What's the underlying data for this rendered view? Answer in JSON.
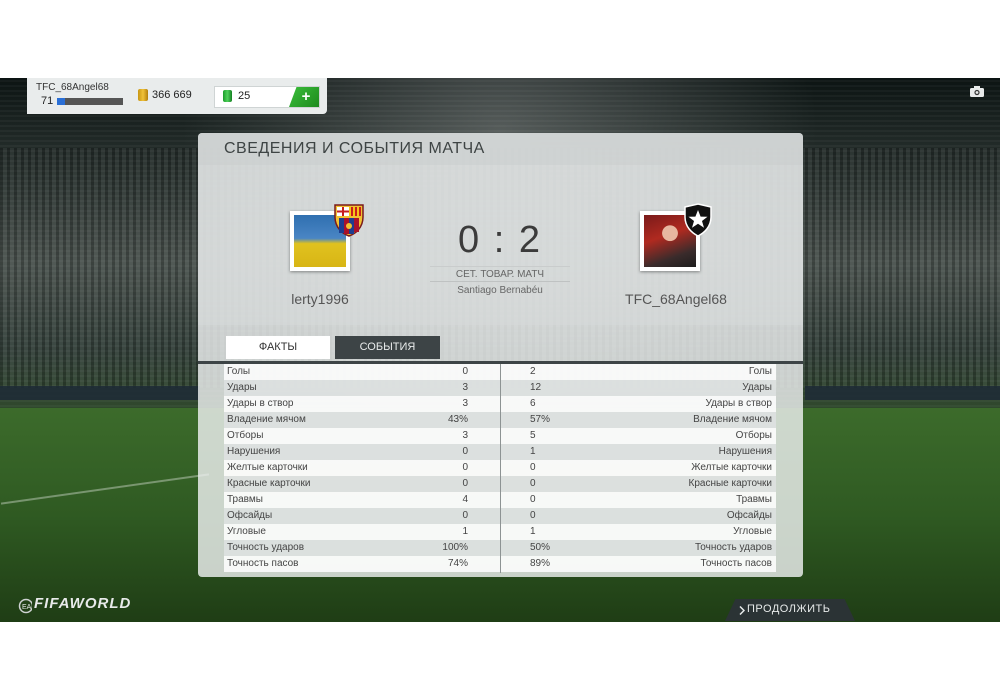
{
  "hud": {
    "player_name": "TFC_68Angel68",
    "level": "71",
    "coins": "366 669",
    "points": "25",
    "add_label": "+"
  },
  "panel": {
    "title": "СВЕДЕНИЯ И СОБЫТИЯ МАТЧА",
    "home_name": "lerty1996",
    "away_name": "TFC_68Angel68",
    "score": "0 : 2",
    "match_type": "СЕТ. ТОВАР. МАТЧ",
    "stadium": "Santiago Bernabéu",
    "tabs": [
      "ФАКТЫ",
      "СОБЫТИЯ"
    ]
  },
  "stats": [
    {
      "label": "Голы",
      "home": "0",
      "away": "2"
    },
    {
      "label": "Удары",
      "home": "3",
      "away": "12"
    },
    {
      "label": "Удары в створ",
      "home": "3",
      "away": "6"
    },
    {
      "label": "Владение мячом",
      "home": "43%",
      "away": "57%"
    },
    {
      "label": "Отборы",
      "home": "3",
      "away": "5"
    },
    {
      "label": "Нарушения",
      "home": "0",
      "away": "1"
    },
    {
      "label": "Желтые карточки",
      "home": "0",
      "away": "0"
    },
    {
      "label": "Красные карточки",
      "home": "0",
      "away": "0"
    },
    {
      "label": "Травмы",
      "home": "4",
      "away": "0"
    },
    {
      "label": "Офсайды",
      "home": "0",
      "away": "0"
    },
    {
      "label": "Угловые",
      "home": "1",
      "away": "1"
    },
    {
      "label": "Точность ударов",
      "home": "100%",
      "away": "50%"
    },
    {
      "label": "Точность пасов",
      "home": "74%",
      "away": "89%"
    }
  ],
  "footer": {
    "logo_text": "FIFAWORLD",
    "continue_label": "ПРОДОЛЖИТЬ"
  },
  "icons": {
    "camera": "camera-icon",
    "home_badge": "barcelona-crest-icon",
    "away_badge": "botafogo-star-crest-icon"
  }
}
